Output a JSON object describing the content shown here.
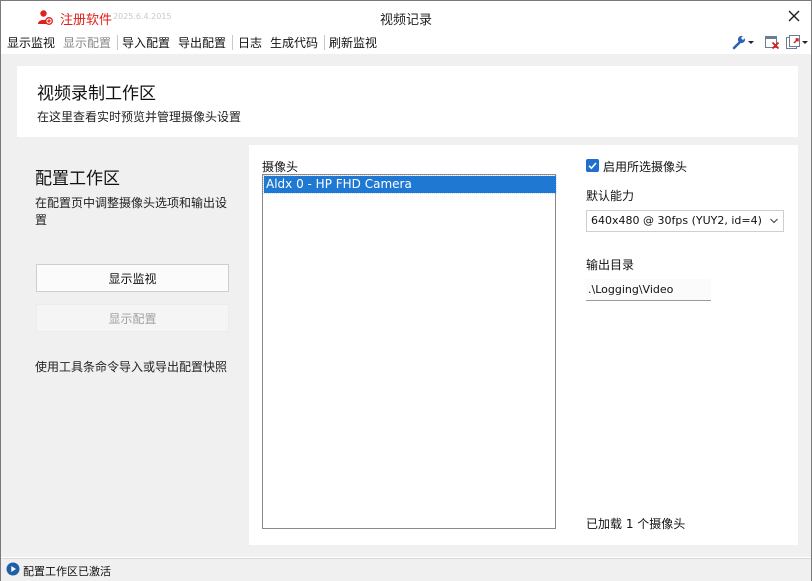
{
  "app": {
    "register_label": "注册软件",
    "version": "2025.6.4.2015",
    "window_title": "视频记录"
  },
  "menu": {
    "items": [
      "显示监视",
      "显示配置",
      "导入配置",
      "导出配置",
      "日志",
      "生成代码",
      "刷新监视"
    ]
  },
  "header": {
    "title": "视频录制工作区",
    "subtitle": "在这里查看实时预览并管理摄像头设置"
  },
  "left": {
    "title": "配置工作区",
    "desc": "在配置页中调整摄像头选项和输出设置",
    "show_monitor_label": "显示监视",
    "show_config_label": "显示配置",
    "note": "使用工具条命令导入或导出配置快照"
  },
  "camera": {
    "label": "摄像头",
    "items": [
      "Aldx 0 - HP FHD Camera"
    ],
    "enable_label": "启用所选摄像头",
    "enabled": true,
    "capability_label": "默认能力",
    "capability_value": "640x480 @ 30fps (YUY2, id=4)",
    "output_label": "输出目录",
    "output_value": ".\\Logging\\Video",
    "loaded_text": "已加载 1 个摄像头"
  },
  "status": {
    "text": "配置工作区已激活"
  },
  "colors": {
    "accent": "#1f78d2",
    "register": "#e0201b",
    "checkbox": "#1f6fd0"
  },
  "icons": [
    "register-icon",
    "close-icon",
    "wrench-icon",
    "clear-icon",
    "export-icon",
    "play-icon",
    "chevron-down-icon"
  ]
}
